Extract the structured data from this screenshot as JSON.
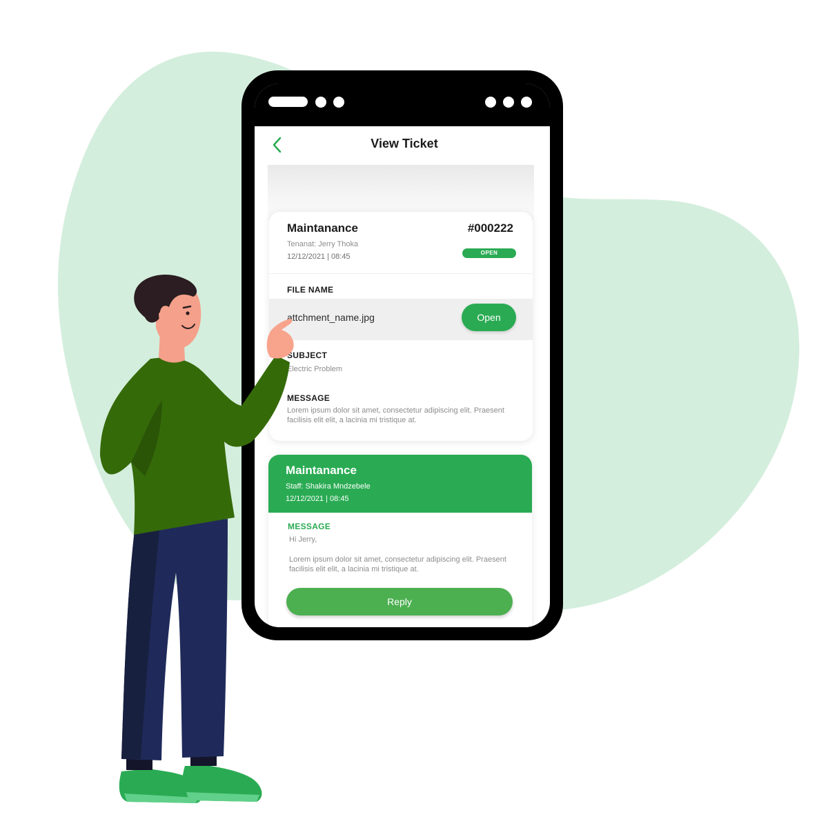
{
  "screen": {
    "title": "View Ticket"
  },
  "ticket": {
    "category": "Maintanance",
    "id": "#000222",
    "tenant": "Tenanat: Jerry Thoka",
    "date": "12/12/2021  |  08:45",
    "status": "OPEN",
    "file_label": "FILE NAME",
    "file_name": "attchment_name.jpg",
    "open_button": "Open",
    "subject_label": "SUBJECT",
    "subject": "Electric Problem",
    "message_label": "MESSAGE",
    "message": "Lorem ipsum dolor sit amet, consectetur adipiscing elit. Praesent facilisis elit elit, a lacinia mi tristique at."
  },
  "reply_card": {
    "category": "Maintanance",
    "staff": "Staff: Shakira Mndzebele",
    "date": "12/12/2021  |  08:45",
    "message_label": "MESSAGE",
    "greeting": "Hi Jerry,",
    "message": "Lorem ipsum dolor sit amet, consectetur adipiscing elit. Praesent facilisis elit elit, a lacinia mi tristique at.",
    "reply_button": "Reply"
  },
  "colors": {
    "accent": "#2aab53",
    "background_blob": "#d4eedd",
    "phone_frame": "#000000"
  },
  "icons": [
    "back-chevron-icon"
  ]
}
